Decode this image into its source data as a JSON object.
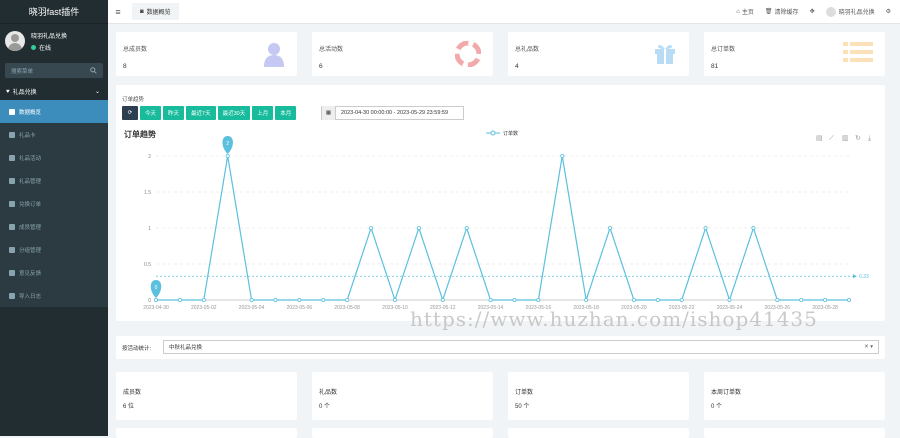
{
  "app": {
    "title": "晓羽fast插件"
  },
  "user": {
    "name": "晓羽礼品兑换",
    "status": "在线"
  },
  "search": {
    "placeholder": "搜索菜单"
  },
  "menu": {
    "group": "礼品兑换",
    "items": [
      {
        "label": "数据概览",
        "icon": "dashboard-icon",
        "active": true
      },
      {
        "label": "礼品卡",
        "icon": "card-icon"
      },
      {
        "label": "礼品活动",
        "icon": "tag-icon"
      },
      {
        "label": "礼品管理",
        "icon": "gift-icon"
      },
      {
        "label": "兑换订单",
        "icon": "list-icon"
      },
      {
        "label": "成员管理",
        "icon": "user-icon"
      },
      {
        "label": "分组管理",
        "icon": "users-icon"
      },
      {
        "label": "意见反馈",
        "icon": "comment-icon"
      },
      {
        "label": "导入日志",
        "icon": "import-icon"
      }
    ]
  },
  "topbar": {
    "tab": "数据概览",
    "home": "主页",
    "clear_cache": "清除缓存",
    "user": "晓羽礼品兑换"
  },
  "stats": [
    {
      "title": "总成员数",
      "value": "8",
      "icon": "user-icon",
      "color": "#c5c8f2"
    },
    {
      "title": "总活动数",
      "value": "6",
      "icon": "lifebuoy-icon",
      "color": "#f2a9a9"
    },
    {
      "title": "总礼品数",
      "value": "4",
      "icon": "gift-icon",
      "color": "#b8dcf5"
    },
    {
      "title": "总订单数",
      "value": "81",
      "icon": "list-icon",
      "color": "#fbe0b8"
    }
  ],
  "trend": {
    "section_label": "订单趋势",
    "buttons": [
      "今天",
      "昨天",
      "最近7天",
      "最近30天",
      "上月",
      "本月"
    ],
    "date_range": "2023-04-30 00:00:00 - 2023-05-29 23:59:59"
  },
  "chart_data": {
    "type": "line",
    "title": "订单趋势",
    "legend": "订单数",
    "legend_position": "top",
    "x": [
      "2023-04-30",
      "2023-05-01",
      "2023-05-02",
      "2023-05-03",
      "2023-05-04",
      "2023-05-05",
      "2023-05-06",
      "2023-05-07",
      "2023-05-08",
      "2023-05-09",
      "2023-05-10",
      "2023-05-11",
      "2023-05-12",
      "2023-05-13",
      "2023-05-14",
      "2023-05-15",
      "2023-05-16",
      "2023-05-17",
      "2023-05-18",
      "2023-05-19",
      "2023-05-20",
      "2023-05-21",
      "2023-05-22",
      "2023-05-23",
      "2023-05-24",
      "2023-05-25",
      "2023-05-26",
      "2023-05-27",
      "2023-05-28",
      "2023-05-29"
    ],
    "xticks": [
      "2023-04-30",
      "2023-05-02",
      "2023-05-04",
      "2023-05-06",
      "2023-05-08",
      "2023-05-10",
      "2023-05-12",
      "2023-05-14",
      "2023-05-16",
      "2023-05-18",
      "2023-05-20",
      "2023-05-22",
      "2023-05-24",
      "2023-05-26",
      "2023-05-28"
    ],
    "values": [
      0,
      0,
      0,
      2,
      0,
      0,
      0,
      0,
      0,
      1,
      0,
      1,
      0,
      1,
      0,
      0,
      0,
      2,
      0,
      1,
      0,
      0,
      0,
      1,
      0,
      1,
      0,
      0,
      0,
      0
    ],
    "ylim": [
      0,
      2
    ],
    "yticks": [
      "0",
      "0.5",
      "1",
      "1.5",
      "2"
    ],
    "average": 0.33,
    "average_label": "0.33",
    "max_label": "2",
    "min_label": "0",
    "grid": "horizontal dashed",
    "color": "#5bc0de"
  },
  "filter": {
    "label": "按活动统计:",
    "value": "中秋礼品兑换"
  },
  "bottom_stats": [
    {
      "title": "成员数",
      "value": "6 位"
    },
    {
      "title": "礼品数",
      "value": "0 个"
    },
    {
      "title": "订单数",
      "value": "50 个"
    },
    {
      "title": "本周订单数",
      "value": "0 个"
    }
  ],
  "watermark": "https://www.huzhan.com/ishop41435"
}
